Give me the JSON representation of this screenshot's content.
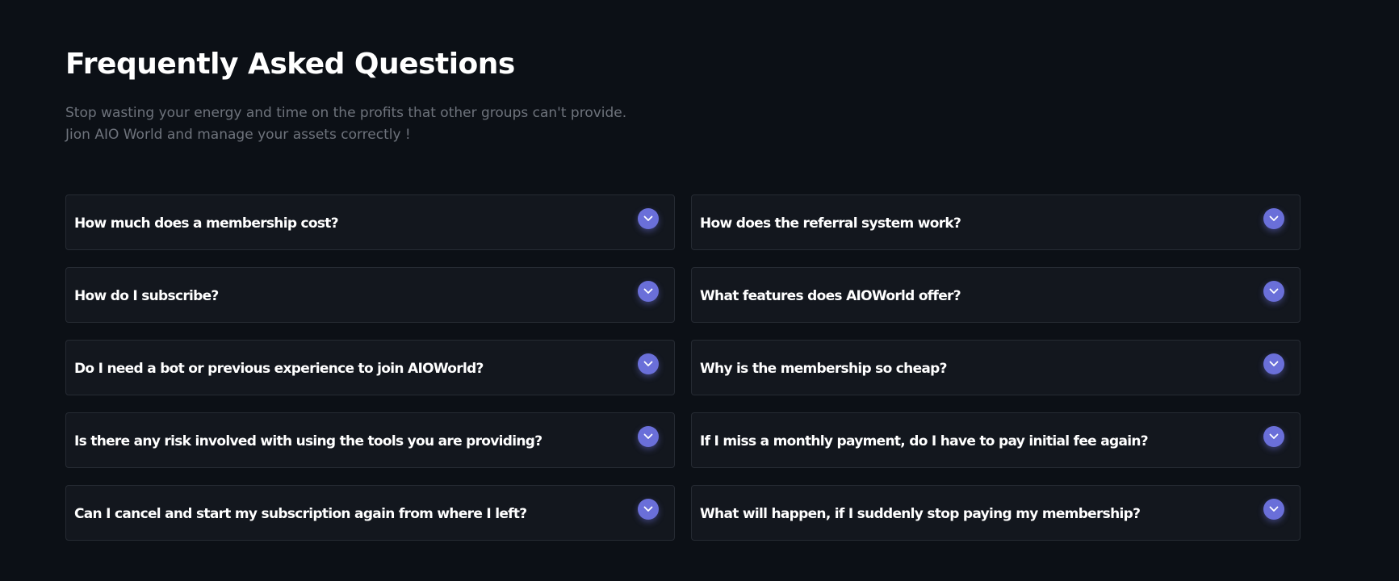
{
  "faq": {
    "title": "Frequently Asked Questions",
    "subtitle_lines": [
      "Stop wasting your energy and time on the profits that other groups can't provide.",
      "Jion AIO World and manage your assets correctly !"
    ],
    "toggle_icon": "chevron-down-icon",
    "accent_color": "#6a6fd9",
    "items": [
      {
        "question": "How much does a membership cost?"
      },
      {
        "question": "How does the referral system work?"
      },
      {
        "question": "How do I subscribe?"
      },
      {
        "question": "What features does AIOWorld offer?"
      },
      {
        "question": "Do I need a bot or previous experience to join AIOWorld?"
      },
      {
        "question": "Why is the membership so cheap?"
      },
      {
        "question": "Is there any risk involved with using the tools you are providing?"
      },
      {
        "question": "If I miss a monthly payment, do I have to pay initial fee again?"
      },
      {
        "question": "Can I cancel and start my subscription again from where I left?"
      },
      {
        "question": "What will happen, if I suddenly stop paying my membership?"
      }
    ]
  }
}
